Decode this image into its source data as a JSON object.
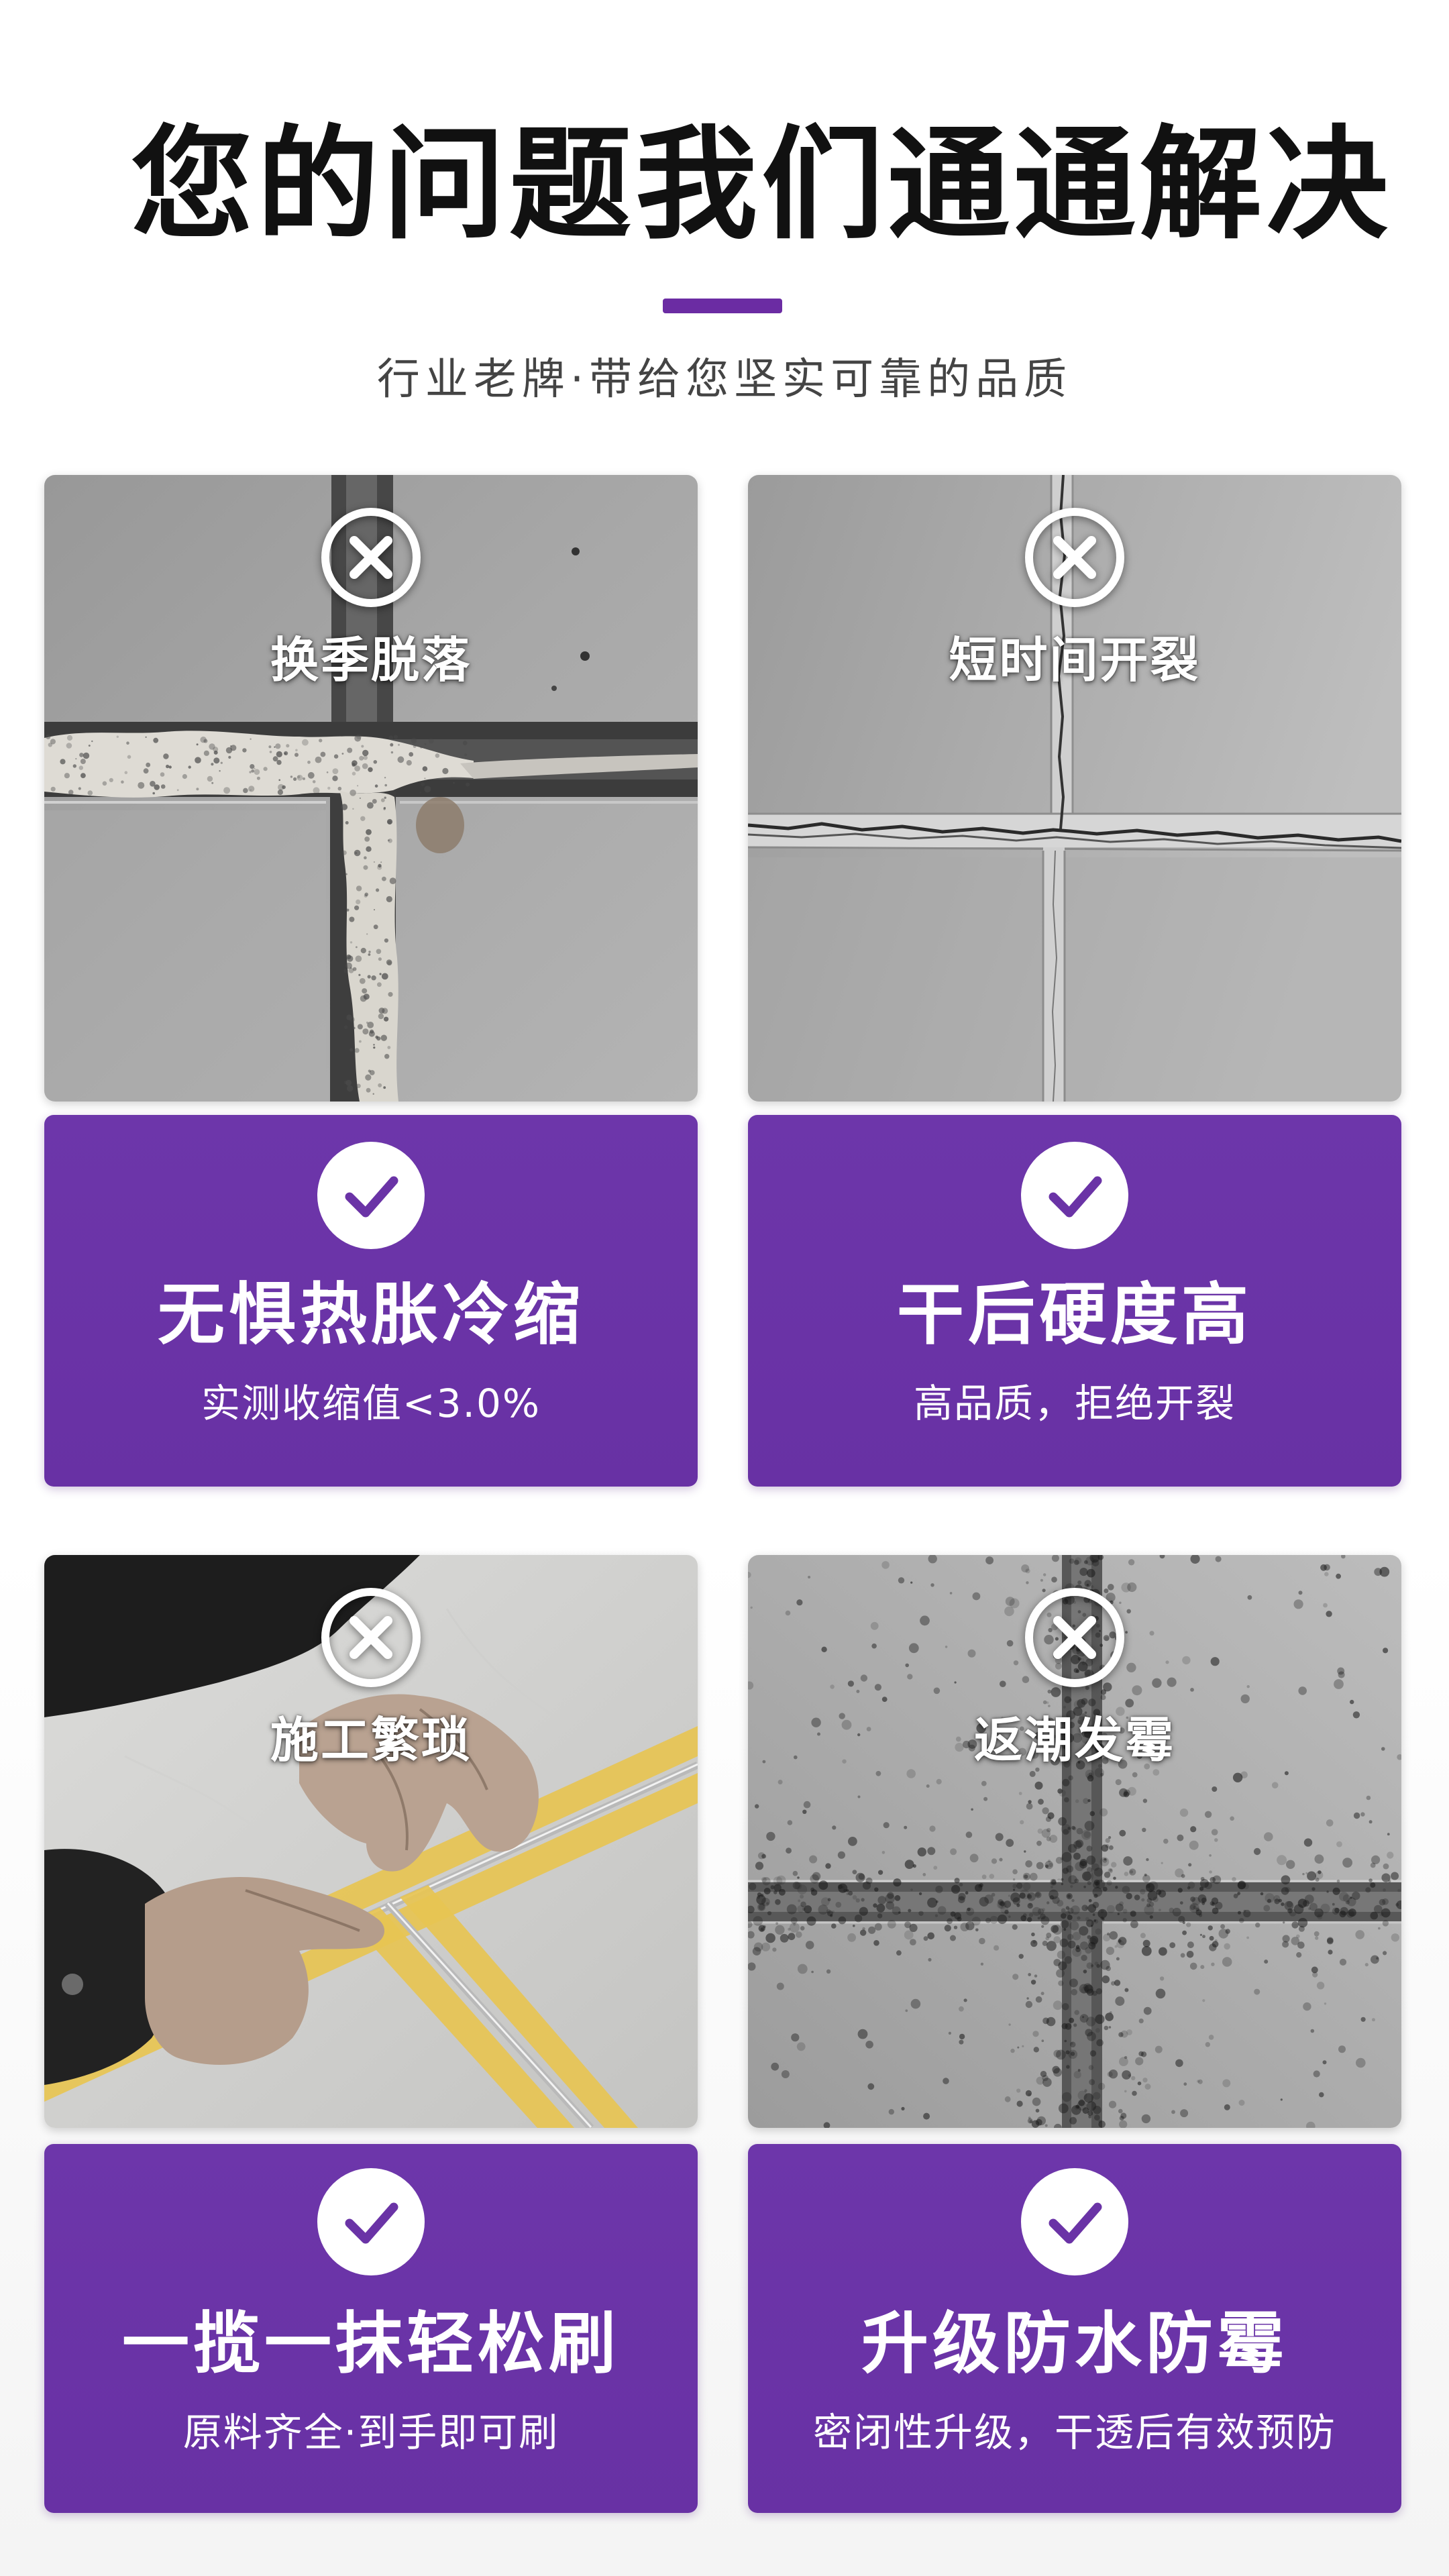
{
  "header": {
    "title": "您的问题我们通通解决",
    "subtitle": "行业老牌·带给您坚实可靠的品质"
  },
  "theme": {
    "accent": "#6a33a6",
    "title_color": "#111111",
    "subtitle_color": "#444444",
    "panel_text_color": "#ffffff"
  },
  "cards": [
    {
      "problem_icon": "x-circle-icon",
      "problem_label": "换季脱落",
      "solution_icon": "check-circle-icon",
      "solution_title": "无惧热胀冷缩",
      "solution_desc": "实测收缩值<3.0%"
    },
    {
      "problem_icon": "x-circle-icon",
      "problem_label": "短时间开裂",
      "solution_icon": "check-circle-icon",
      "solution_title": "干后硬度高",
      "solution_desc": "高品质，拒绝开裂"
    },
    {
      "problem_icon": "x-circle-icon",
      "problem_label": "施工繁琐",
      "solution_icon": "check-circle-icon",
      "solution_title": "一揽一抹轻松刷",
      "solution_desc": "原料齐全·到手即可刷"
    },
    {
      "problem_icon": "x-circle-icon",
      "problem_label": "返潮发霉",
      "solution_icon": "check-circle-icon",
      "solution_title": "升级防水防霉",
      "solution_desc": "密闭性升级，干透后有效预防"
    }
  ]
}
